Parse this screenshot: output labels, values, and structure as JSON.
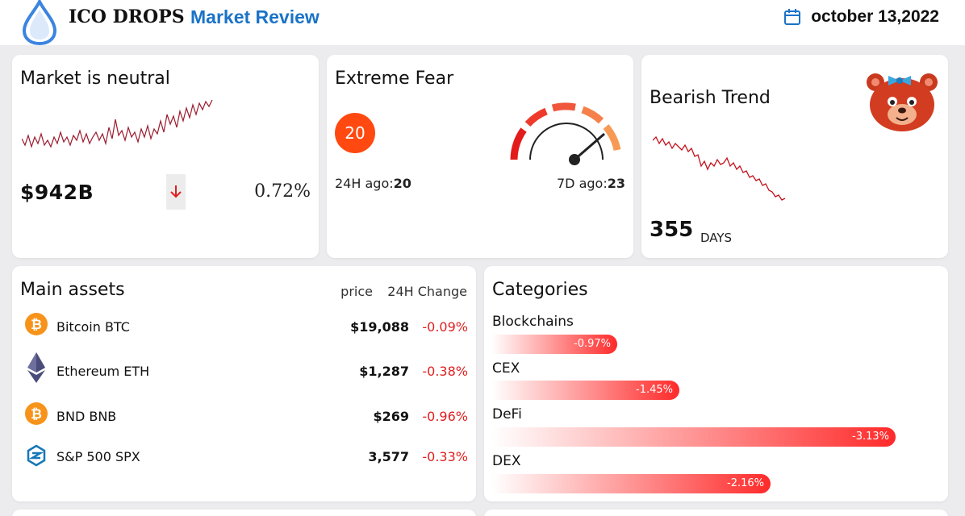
{
  "header": {
    "brand": "ICO DROPS",
    "section": "Market Review",
    "date": "october 13,2022"
  },
  "market": {
    "title": "Market is neutral",
    "cap": "$942B",
    "change": "0.72%",
    "direction_icon": "arrow-down-icon"
  },
  "fear": {
    "title": "Extreme Fear",
    "value": "20",
    "ago24_label": "24H ago:",
    "ago24_value": "20",
    "ago7_label": "7D ago:",
    "ago7_value": "23"
  },
  "trend": {
    "title": "Bearish Trend",
    "days": "355",
    "days_label": "DAYS",
    "mascot_icon": "bear-mascot-icon"
  },
  "assets": {
    "title": "Main assets",
    "col_price": "price",
    "col_change": "24H Change",
    "rows": [
      {
        "name": "Bitcoin  BTC",
        "price": "$19,088",
        "change": "-0.09%",
        "icon": "bitcoin-icon"
      },
      {
        "name": "Ethereum  ETH",
        "price": "$1,287",
        "change": "-0.38%",
        "icon": "ethereum-icon"
      },
      {
        "name": "BND  BNB",
        "price": "$269",
        "change": "-0.96%",
        "icon": "bitcoin-icon"
      },
      {
        "name": "S&P  500  SPX",
        "price": "3,577",
        "change": "-0.33%",
        "icon": "sp500-icon"
      }
    ]
  },
  "categories": {
    "title": "Categories",
    "items": [
      {
        "name": "Blockchains",
        "value": "-0.97%",
        "pct": -0.97
      },
      {
        "name": "CEX",
        "value": "-1.45%",
        "pct": -1.45
      },
      {
        "name": "DeFi",
        "value": "-3.13%",
        "pct": -3.13
      },
      {
        "name": "DEX",
        "value": "-2.16%",
        "pct": -2.16
      }
    ]
  },
  "colors": {
    "accent_blue": "#1a73c7",
    "fear_orange": "#ff4910",
    "negative_red": "#e01e1e",
    "spark_red": "#9b1c2e"
  }
}
